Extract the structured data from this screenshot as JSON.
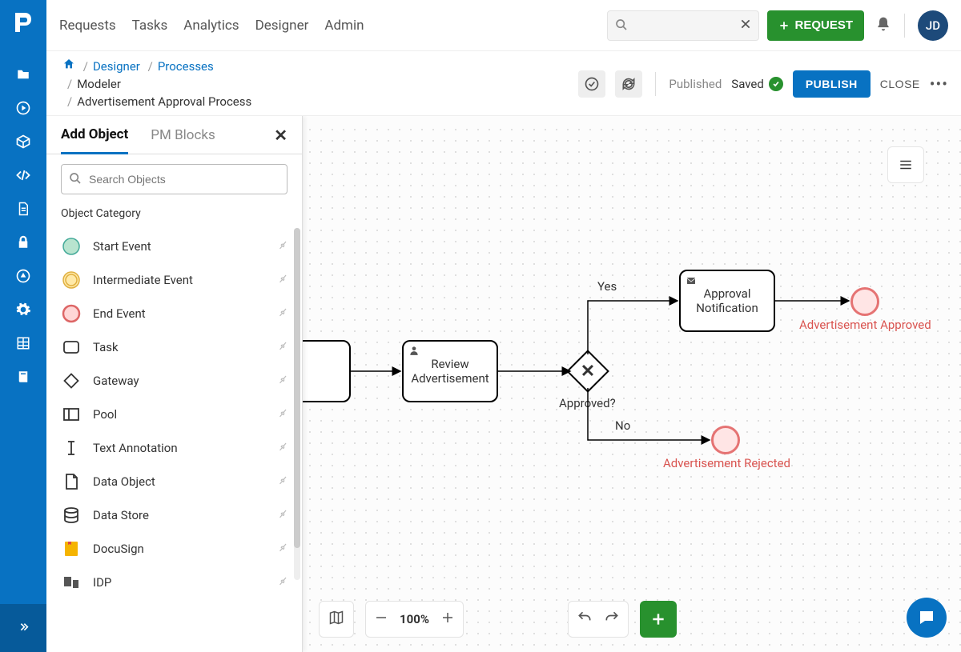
{
  "nav": {
    "items": [
      "Requests",
      "Tasks",
      "Analytics",
      "Designer",
      "Admin"
    ]
  },
  "search": {
    "placeholder": ""
  },
  "request_btn": "REQUEST",
  "avatar": "JD",
  "breadcrumb": {
    "designer": "Designer",
    "processes": "Processes",
    "modeler": "Modeler",
    "current": "Advertisement Approval Process"
  },
  "header": {
    "published": "Published",
    "saved": "Saved",
    "publish_btn": "PUBLISH",
    "close_btn": "CLOSE"
  },
  "panel": {
    "tab_add": "Add Object",
    "tab_pm": "PM Blocks",
    "search_placeholder": "Search Objects",
    "category_label": "Object Category",
    "objects": [
      "Start Event",
      "Intermediate Event",
      "End Event",
      "Task",
      "Gateway",
      "Pool",
      "Text Annotation",
      "Data Object",
      "Data Store",
      "DocuSign",
      "IDP"
    ]
  },
  "zoom": "100%",
  "diagram": {
    "task_review": "Review Advertisement",
    "task_approval": "Approval Notification",
    "gateway_label": "Approved?",
    "flow_yes": "Yes",
    "flow_no": "No",
    "end_approved": "Advertisement Approved",
    "end_rejected": "Advertisement Rejected"
  }
}
